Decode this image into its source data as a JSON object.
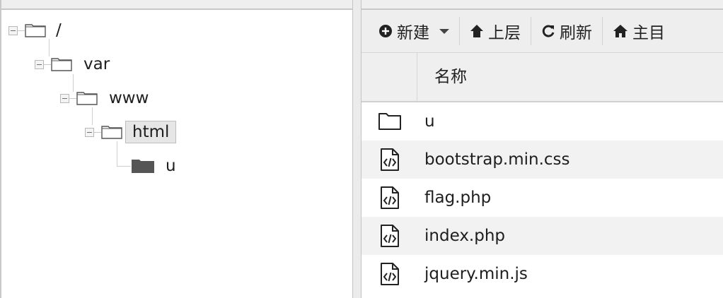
{
  "tree": {
    "nodes": [
      {
        "label": "/",
        "icon": "folder-open-icon",
        "expanded": true
      },
      {
        "label": "var",
        "icon": "folder-open-icon",
        "expanded": true
      },
      {
        "label": "www",
        "icon": "folder-open-icon",
        "expanded": true
      },
      {
        "label": "html",
        "icon": "folder-open-icon",
        "expanded": true,
        "selected": true
      },
      {
        "label": "u",
        "icon": "folder-closed-icon"
      }
    ]
  },
  "toolbar": {
    "new_label": "新建",
    "new_icon": "plus-circle-icon",
    "up_label": "上层",
    "up_icon": "arrow-up-icon",
    "refresh_label": "刷新",
    "refresh_icon": "refresh-icon",
    "home_label": "主目",
    "home_icon": "home-icon"
  },
  "table": {
    "name_header": "名称",
    "rows": [
      {
        "name": "u",
        "icon": "folder-icon"
      },
      {
        "name": "bootstrap.min.css",
        "icon": "code-file-icon"
      },
      {
        "name": "flag.php",
        "icon": "code-file-icon"
      },
      {
        "name": "index.php",
        "icon": "code-file-icon"
      },
      {
        "name": "jquery.min.js",
        "icon": "code-file-icon"
      }
    ]
  }
}
